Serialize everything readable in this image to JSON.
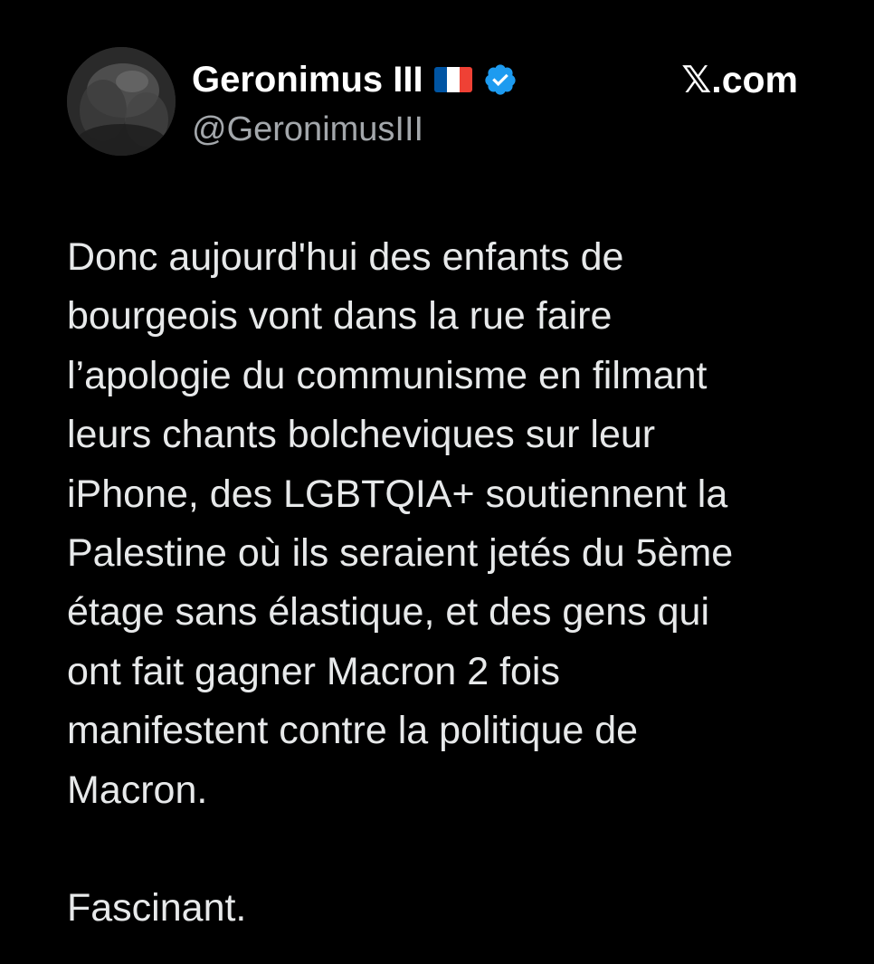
{
  "tweet": {
    "author": {
      "display_name": "Geronimus III",
      "handle": "@GeronimusIII",
      "flag_icon": "france-flag-icon",
      "verified_icon": "verified-badge-icon",
      "verified_color": "#1d9bf0"
    },
    "source": "𝕏.com",
    "body_lines": [
      "Donc aujourd'hui des enfants de",
      "bourgeois vont dans la rue faire",
      "l’apologie du communisme en filmant",
      "leurs chants bolcheviques sur leur",
      "iPhone, des LGBTQIA+ soutiennent la",
      "Palestine où ils seraient jetés du 5ème",
      "étage sans élastique, et des gens qui",
      "ont fait gagner Macron 2 fois",
      "manifestent contre la politique de",
      "Macron."
    ],
    "closing_line": "Fascinant."
  },
  "colors": {
    "background": "#000000",
    "text_primary": "#e7e9ea",
    "text_secondary": "#a3a7ab",
    "flag_blue": "#0055a4",
    "flag_white": "#ffffff",
    "flag_red": "#ef4135"
  }
}
